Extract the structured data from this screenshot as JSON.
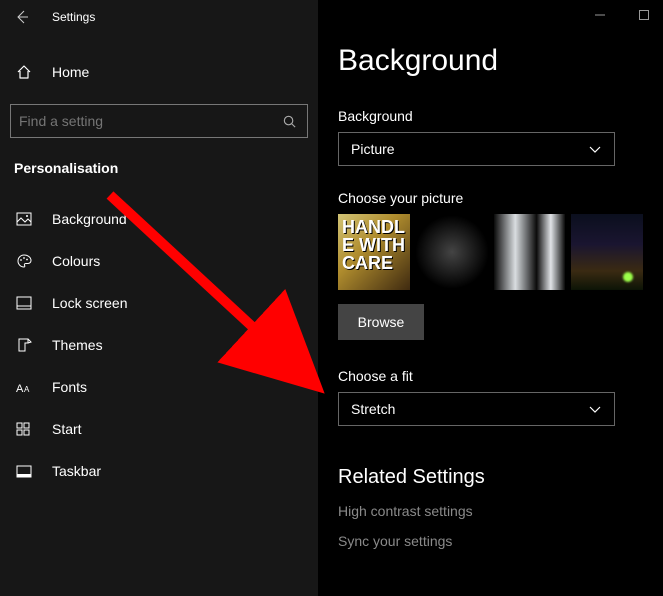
{
  "titlebar": {
    "title": "Settings"
  },
  "home": {
    "label": "Home"
  },
  "search": {
    "placeholder": "Find a setting"
  },
  "section": {
    "label": "Personalisation"
  },
  "nav": {
    "items": [
      {
        "label": "Background"
      },
      {
        "label": "Colours"
      },
      {
        "label": "Lock screen"
      },
      {
        "label": "Themes"
      },
      {
        "label": "Fonts"
      },
      {
        "label": "Start"
      },
      {
        "label": "Taskbar"
      }
    ]
  },
  "page": {
    "title": "Background"
  },
  "background": {
    "label": "Background",
    "selected": "Picture"
  },
  "choosePicture": {
    "label": "Choose your picture",
    "browse": "Browse"
  },
  "fit": {
    "label": "Choose a fit",
    "selected": "Stretch"
  },
  "related": {
    "title": "Related Settings",
    "links": [
      "High contrast settings",
      "Sync your settings"
    ]
  }
}
